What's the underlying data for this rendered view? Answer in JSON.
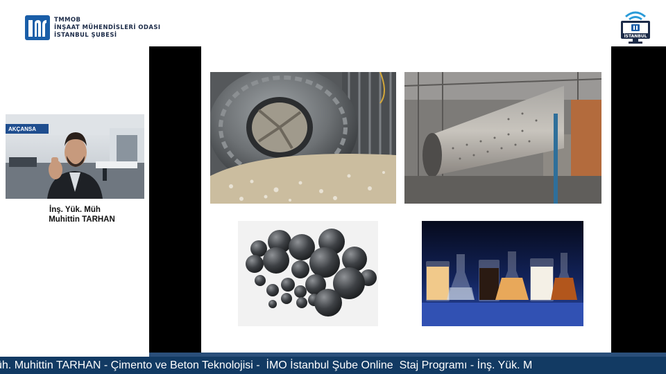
{
  "header": {
    "org_line1": "TMMOB",
    "org_line2": "İNŞAAT MÜHENDİSLERİ ODASI",
    "org_line3": "İSTANBUL ŞUBESİ",
    "badge_label": "İSTANBUL"
  },
  "speaker": {
    "title": "İnş. Yük. Müh",
    "name": "Muhittin TARHAN",
    "backdrop_brand": "AKÇANSA"
  },
  "colors": {
    "brand_blue": "#1a5ea8",
    "ticker_bg": "#123a63",
    "share_bg": "#000000"
  },
  "ticker": {
    "text": "üh. Muhittin TARHAN - Çimento ve Beton Teknolojisi -  İMO İstanbul Şube Online  Staj Programı - İnş. Yük. M"
  },
  "slide": {
    "images": [
      "ball-mill-interior-photo",
      "ball-mill-exterior-photo",
      "grinding-balls-photo",
      "lab-flasks-photo"
    ]
  }
}
